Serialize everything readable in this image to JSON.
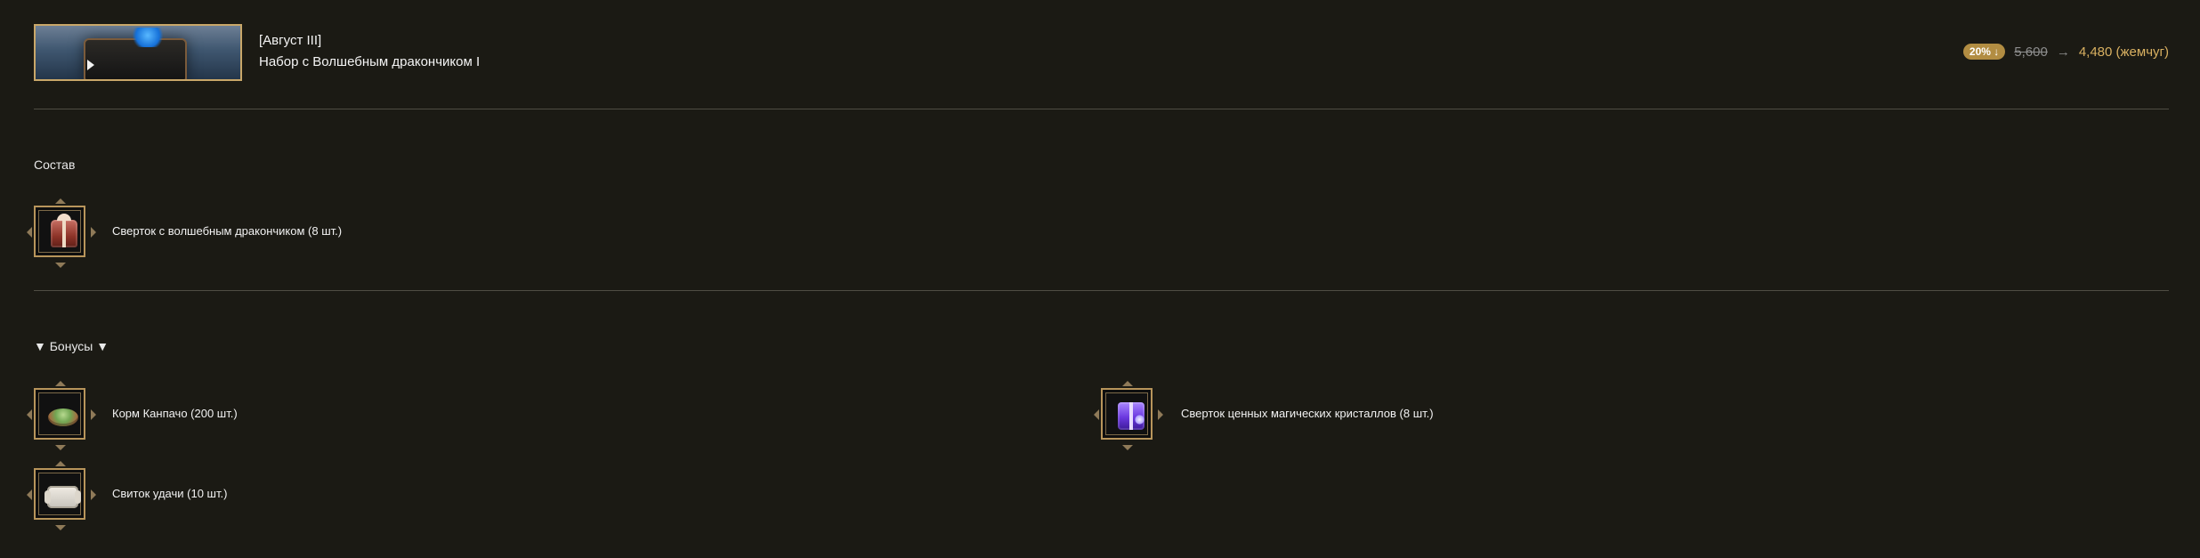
{
  "header": {
    "banner_name": "package-banner",
    "title_line1": "[Август III]",
    "title_line2": "Набор с Волшебным дракончиком I",
    "discount_badge": "20% ↓",
    "old_price": "5,600",
    "arrow": "→",
    "new_price": "4,480 (жемчуг)"
  },
  "composition": {
    "title": "Состав",
    "items": [
      {
        "label": "Сверток с волшебным дракончиком (8 шт.)",
        "icon": "red-gift-box-icon"
      }
    ]
  },
  "bonuses": {
    "title": "▼ Бонусы ▼",
    "items": [
      {
        "label": "Корм Канпачо (200 шт.)",
        "icon": "kanpacho-food-icon"
      },
      {
        "label": "Сверток ценных магических кристаллов (8 шт.)",
        "icon": "purple-crystal-gift-icon"
      },
      {
        "label": "Свиток удачи (10 шт.)",
        "icon": "luck-scroll-icon"
      }
    ]
  },
  "colors": {
    "background": "#1b1a14",
    "accent_gold": "#d8b061",
    "discount_badge": "#b28d42",
    "frame_gold": "#b8955b",
    "divider": "#4f4d43"
  }
}
